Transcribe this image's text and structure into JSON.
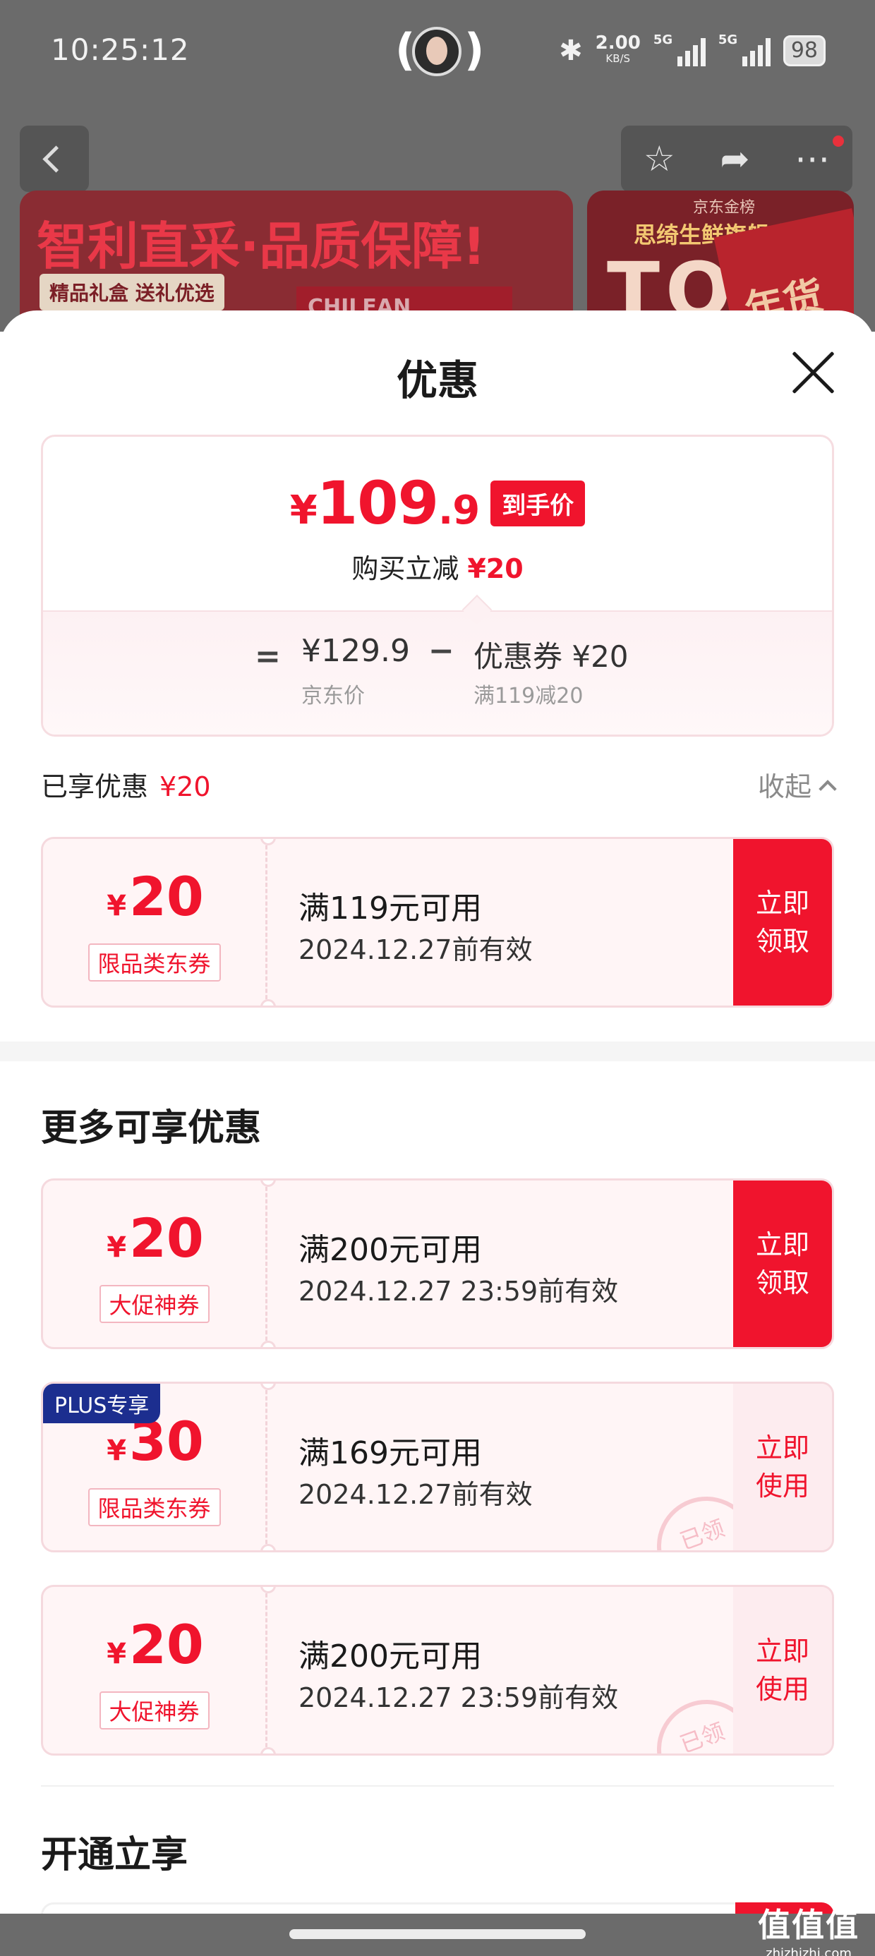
{
  "status_bar": {
    "time": "10:25:12",
    "net_speed": "2.00",
    "net_unit": "KB/S",
    "sig1": "5G",
    "sig2": "5G",
    "battery": "98"
  },
  "background": {
    "banner1_title": "智利直采·品质保障!",
    "banner1_chip": "精品礼盒 送礼优选",
    "banner1_box": "CHILEAN CHERRIES",
    "banner2_rank": "京东金榜",
    "banner2_store": "思绮生鲜旗舰店",
    "banner2_big": "TO",
    "banner2_fest": "年货节"
  },
  "sheet": {
    "title": "优惠"
  },
  "summary": {
    "price_currency": "¥",
    "price_int": "109",
    "price_dec": ".9",
    "price_tag": "到手价",
    "reduce_label": "购买立减",
    "reduce_value": "¥20",
    "eq": "=",
    "jd_price": "¥129.9",
    "jd_label": "京东价",
    "minus": "−",
    "coupon_name": "优惠券 ¥20",
    "coupon_rule": "满119减20"
  },
  "enjoyed": {
    "label": "已享优惠",
    "value": "¥20",
    "collapse_label": "收起"
  },
  "enjoyed_coupons": [
    {
      "currency": "¥",
      "amount": "20",
      "type": "限品类东券",
      "condition": "满119元可用",
      "validity": "2024.12.27前有效",
      "action": "立即\n领取"
    }
  ],
  "more_title": "更多可享优惠",
  "more_coupons": [
    {
      "currency": "¥",
      "amount": "20",
      "type": "大促神券",
      "condition": "满200元可用",
      "validity": "2024.12.27 23:59前有效",
      "action": "立即\n领取"
    },
    {
      "currency": "¥",
      "amount": "30",
      "type": "限品类东券",
      "condition": "满169元可用",
      "validity": "2024.12.27前有效",
      "action": "立即\n使用",
      "badge": "PLUS专享",
      "stamp": "已领"
    },
    {
      "currency": "¥",
      "amount": "20",
      "type": "大促神券",
      "condition": "满200元可用",
      "validity": "2024.12.27 23:59前有效",
      "action": "立即\n使用",
      "stamp": "已领"
    }
  ],
  "open_title": "开通立享",
  "watermark": {
    "logo": "值值值",
    "site": "zhizhizhi.com"
  },
  "colors": {
    "accent": "#f0142d",
    "plus": "#1c2e8f"
  }
}
